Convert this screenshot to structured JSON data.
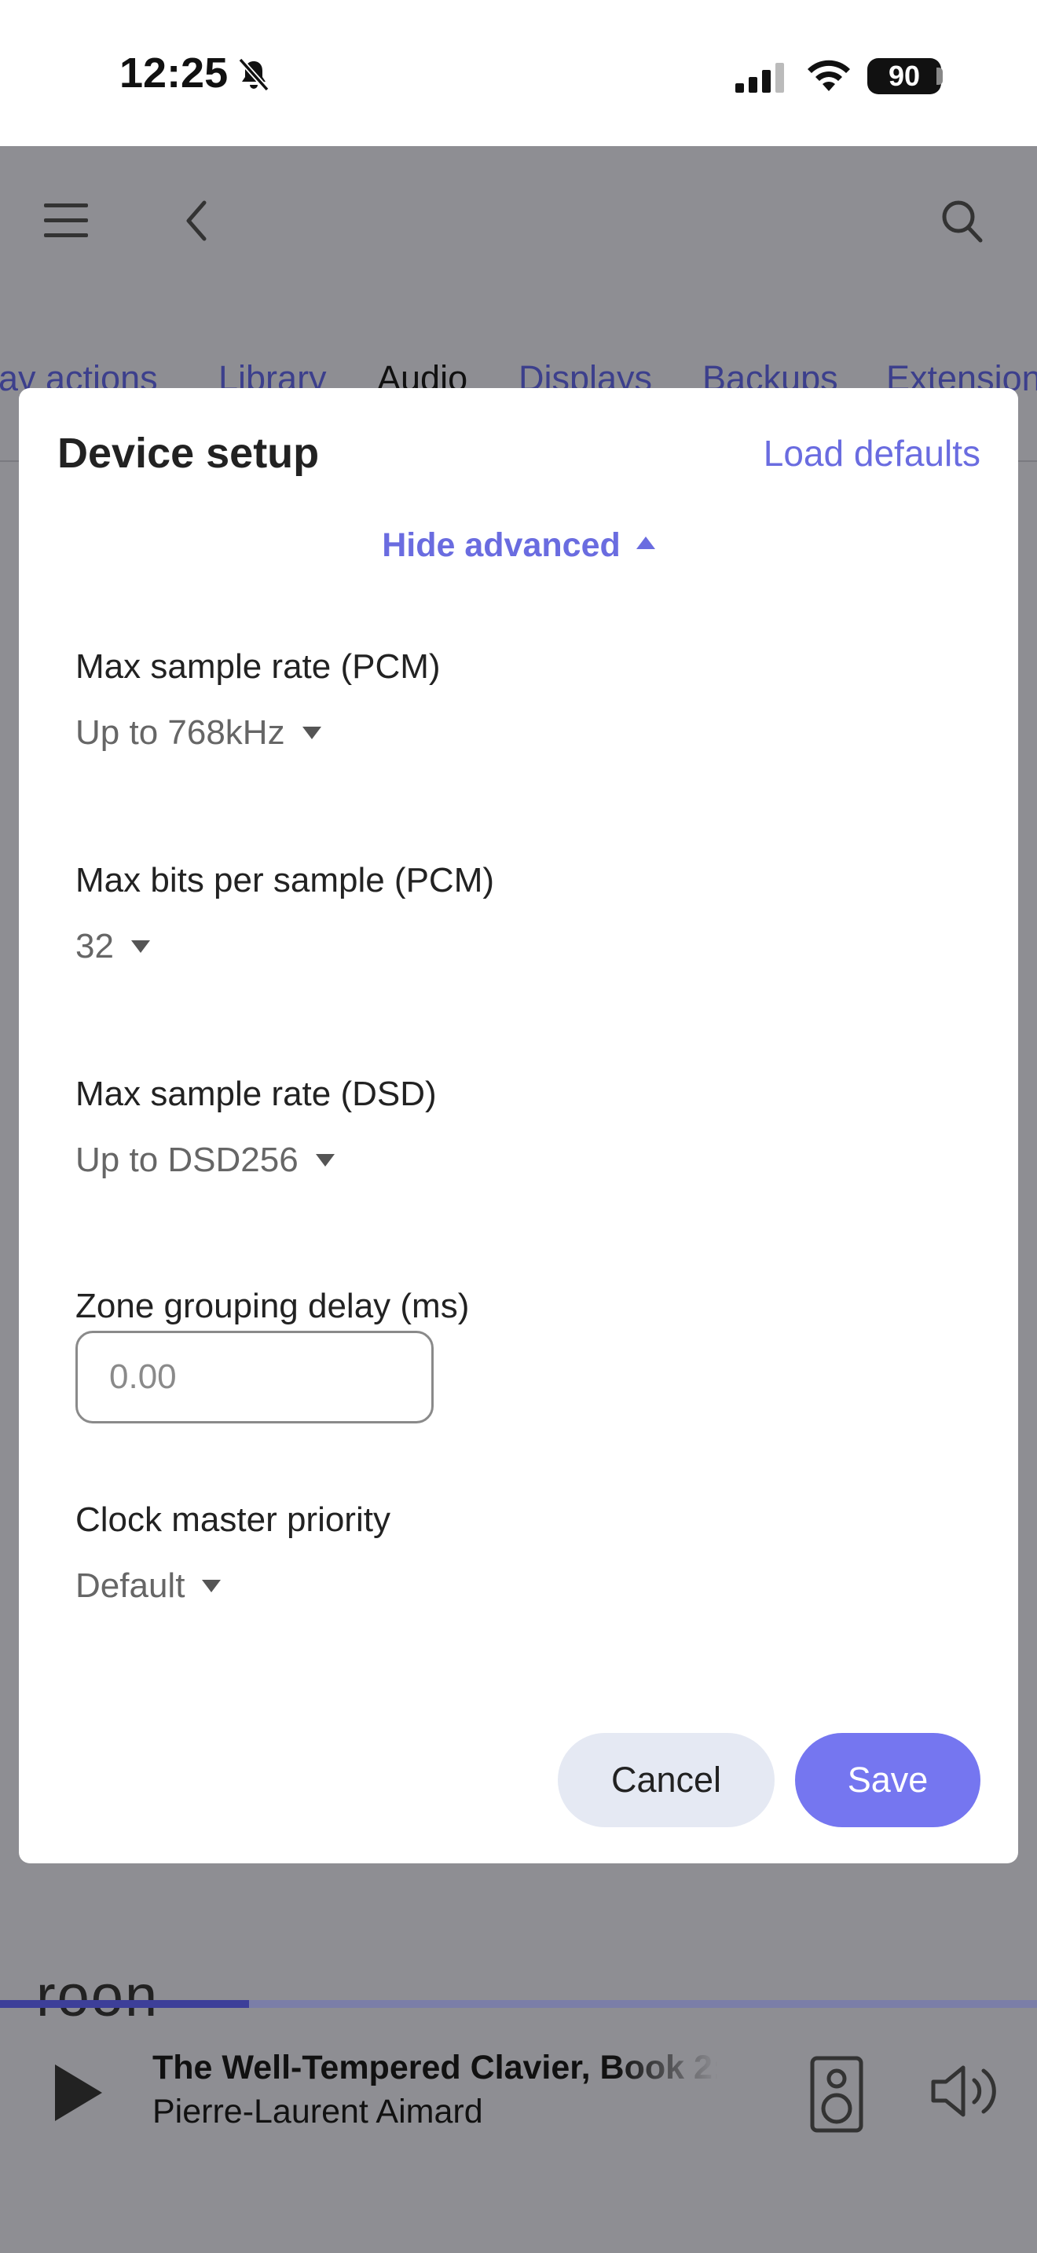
{
  "status_bar": {
    "time": "12:25",
    "battery": "90",
    "icons": [
      "bell-slash-icon",
      "signal-icon",
      "wifi-icon",
      "battery-icon"
    ]
  },
  "header": {
    "icons": [
      "menu-icon",
      "back-icon",
      "search-icon"
    ]
  },
  "tabs": [
    "lay actions",
    "Library",
    "Audio",
    "Displays",
    "Backups",
    "Extensions"
  ],
  "active_tab": "Audio",
  "modal": {
    "title": "Device setup",
    "load_defaults": "Load defaults",
    "hide_advanced": "Hide advanced",
    "fields": {
      "max_sample_rate_pcm": {
        "label": "Max sample rate (PCM)",
        "value": "Up to 768kHz"
      },
      "max_bits_pcm": {
        "label": "Max bits per sample (PCM)",
        "value": "32"
      },
      "max_sample_rate_dsd": {
        "label": "Max sample rate (DSD)",
        "value": "Up to DSD256"
      },
      "zone_grouping_delay": {
        "label": "Zone grouping delay (ms)",
        "placeholder": "0.00"
      },
      "clock_master_priority": {
        "label": "Clock master priority",
        "value": "Default"
      }
    },
    "cancel": "Cancel",
    "save": "Save"
  },
  "player": {
    "logo": "roon",
    "track_title": "The Well-Tempered Clavier, Book 2:",
    "artist": "Pierre-Laurent Aimard",
    "progress": 0.24,
    "icons": [
      "play-icon",
      "speaker-icon",
      "volume-icon"
    ]
  },
  "colors": {
    "accent": "#6a6ce0",
    "save_button": "#7576f0",
    "cancel_button": "#e5e9f3",
    "overlay": "#8e8e93",
    "tab_link": "#3c3f8c"
  }
}
